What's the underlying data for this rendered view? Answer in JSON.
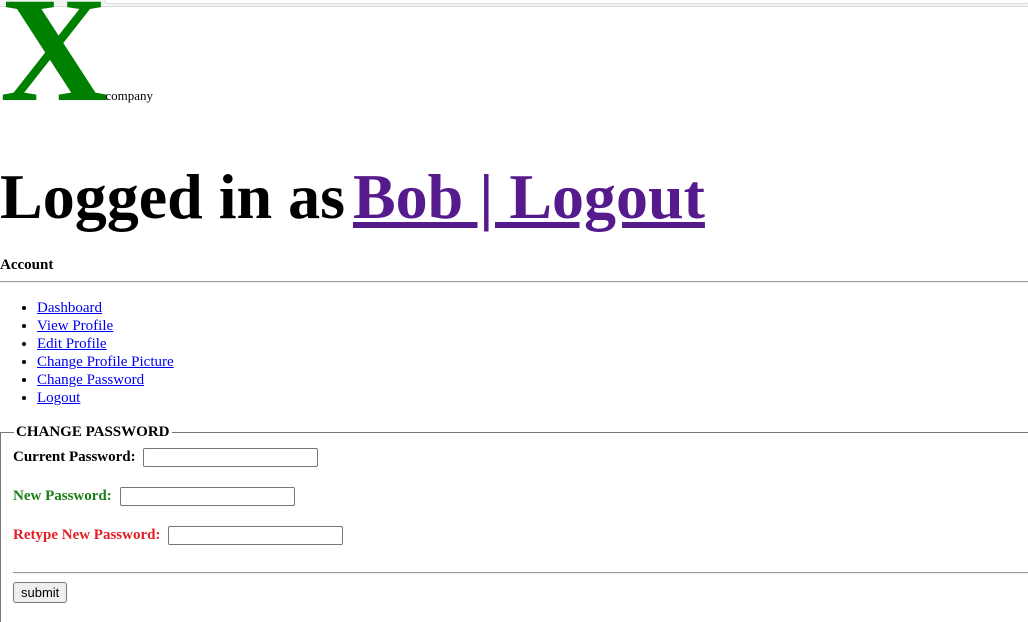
{
  "logo": {
    "mark": "X",
    "word": "company",
    "mark_color": "#008000"
  },
  "header": {
    "logged_in_prefix": "Logged in as",
    "logout_link": "Bob | Logout",
    "link_color": "#551a8b"
  },
  "account": {
    "heading": "Account"
  },
  "nav": {
    "items": [
      {
        "label": "Dashboard"
      },
      {
        "label": "View Profile"
      },
      {
        "label": "Edit Profile"
      },
      {
        "label": "Change Profile Picture"
      },
      {
        "label": "Change Password"
      },
      {
        "label": "Logout"
      }
    ],
    "link_color": "#0000ee"
  },
  "form": {
    "legend": "CHANGE PASSWORD",
    "fields": {
      "current": {
        "label": "Current Password:",
        "value": "",
        "color": "#000000"
      },
      "new": {
        "label": "New Password:",
        "value": "",
        "color": "#1a7f1a"
      },
      "retype": {
        "label": "Retype New Password:",
        "value": "",
        "color": "#e31e24"
      }
    },
    "submit_label": "submit"
  }
}
